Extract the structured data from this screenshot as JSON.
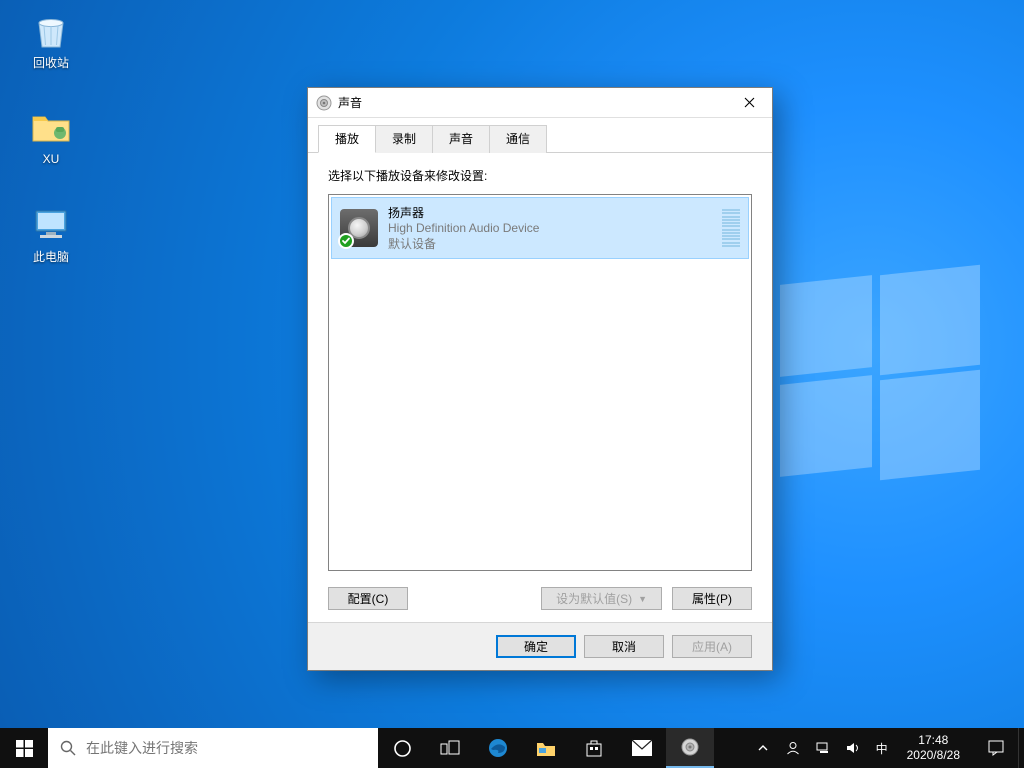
{
  "desktop": {
    "icons": [
      {
        "name": "recycle-bin",
        "label": "回收站"
      },
      {
        "name": "folder-xu",
        "label": "XU"
      },
      {
        "name": "this-pc",
        "label": "此电脑"
      }
    ]
  },
  "dialog": {
    "title": "声音",
    "tabs": [
      {
        "label": "播放",
        "active": true
      },
      {
        "label": "录制",
        "active": false
      },
      {
        "label": "声音",
        "active": false
      },
      {
        "label": "通信",
        "active": false
      }
    ],
    "instruction": "选择以下播放设备来修改设置:",
    "devices": [
      {
        "name": "扬声器",
        "driver": "High Definition Audio Device",
        "status": "默认设备",
        "selected": true,
        "default": true
      }
    ],
    "buttons": {
      "configure": "配置(C)",
      "set_default": "设为默认值(S)",
      "properties": "属性(P)"
    },
    "bottom": {
      "ok": "确定",
      "cancel": "取消",
      "apply": "应用(A)"
    }
  },
  "taskbar": {
    "search_placeholder": "在此键入进行搜索",
    "ime": "中",
    "time": "17:48",
    "date": "2020/8/28"
  }
}
